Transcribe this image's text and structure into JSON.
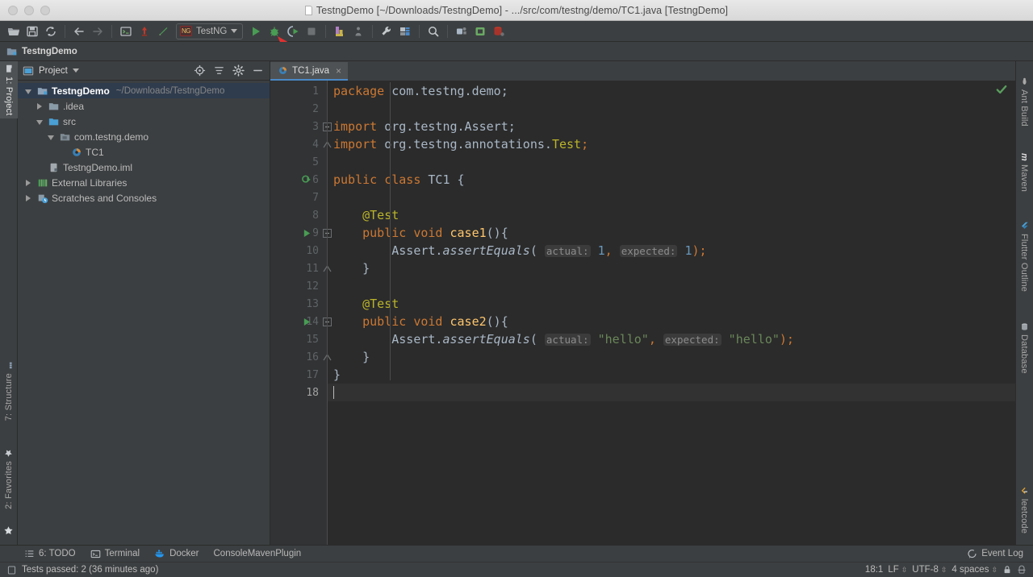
{
  "window": {
    "title": "TestngDemo [~/Downloads/TestngDemo] - .../src/com/testng/demo/TC1.java [TestngDemo]",
    "traffic_lights": [
      "close",
      "minimize",
      "zoom"
    ]
  },
  "toolbar": {
    "icons": [
      {
        "name": "open-project-icon",
        "title": "Open"
      },
      {
        "name": "save-all-icon",
        "title": "Save All"
      },
      {
        "name": "sync-icon",
        "title": "Synchronize"
      },
      {
        "name": "back-icon",
        "title": "Back"
      },
      {
        "name": "forward-icon",
        "title": "Forward"
      },
      {
        "name": "toggle-terminal-icon",
        "title": "Terminal"
      },
      {
        "name": "revert-icon",
        "title": "Revert"
      },
      {
        "name": "update-project-icon",
        "title": "Update Project"
      },
      {
        "name": "run-icon",
        "title": "Run"
      },
      {
        "name": "debug-icon",
        "title": "Debug"
      },
      {
        "name": "run-coverage-icon",
        "title": "Run with Coverage"
      },
      {
        "name": "stop-icon",
        "title": "Stop"
      },
      {
        "name": "build-icon",
        "title": "Build"
      },
      {
        "name": "profiler-icon",
        "title": "Profiler"
      },
      {
        "name": "settings-wrench-icon",
        "title": "Settings"
      },
      {
        "name": "project-structure-icon",
        "title": "Project Structure"
      },
      {
        "name": "search-icon",
        "title": "Search Everywhere"
      },
      {
        "name": "sdk-manager-icon",
        "title": "SDK Manager"
      },
      {
        "name": "avd-manager-icon",
        "title": "AVD Manager"
      },
      {
        "name": "database-icon",
        "title": "Database"
      }
    ],
    "run_config": {
      "icon": "testng-config-icon",
      "icon_text": "NG",
      "label": "TestNG",
      "caret": "chevron-down-icon"
    }
  },
  "navbar": {
    "crumb": "TestngDemo",
    "icon": "module-icon"
  },
  "left_strip": {
    "tabs": [
      {
        "label": "1: Project",
        "selected": true,
        "icon": "project-icon"
      },
      {
        "label": "7: Structure",
        "selected": false,
        "icon": "structure-icon"
      },
      {
        "label": "2: Favorites",
        "selected": false,
        "icon": "favorites-star-icon"
      }
    ],
    "bottom_icon": "favorites-star-icon"
  },
  "right_strip": {
    "tabs": [
      {
        "label": "Ant Build",
        "icon": "ant-icon"
      },
      {
        "label": "Maven",
        "icon": "maven-icon"
      },
      {
        "label": "Flutter Outline",
        "icon": "flutter-icon"
      },
      {
        "label": "Database",
        "icon": "database-icon"
      },
      {
        "label": "leetcode",
        "icon": "leetcode-icon"
      }
    ]
  },
  "project_panel": {
    "title": "Project",
    "title_icon": "project-window-icon",
    "caret": "chevron-down-icon",
    "header_icons": [
      {
        "name": "scroll-from-source-icon"
      },
      {
        "name": "collapse-all-icon"
      },
      {
        "name": "gear-icon"
      },
      {
        "name": "hide-icon"
      }
    ],
    "tree": [
      {
        "label": "TestngDemo",
        "sublabel": "~/Downloads/TestngDemo",
        "indent": 0,
        "twisty": "down",
        "icon": "module-icon",
        "selected": true,
        "bold": true
      },
      {
        "label": ".idea",
        "sublabel": "",
        "indent": 1,
        "twisty": "right",
        "icon": "folder-icon",
        "selected": false,
        "bold": false
      },
      {
        "label": "src",
        "sublabel": "",
        "indent": 1,
        "twisty": "down",
        "icon": "source-folder-icon",
        "selected": false,
        "bold": false
      },
      {
        "label": "com.testng.demo",
        "sublabel": "",
        "indent": 2,
        "twisty": "down",
        "icon": "package-icon",
        "selected": false,
        "bold": false
      },
      {
        "label": "TC1",
        "sublabel": "",
        "indent": 3,
        "twisty": "none",
        "icon": "java-class-icon",
        "selected": false,
        "bold": false
      },
      {
        "label": "TestngDemo.iml",
        "sublabel": "",
        "indent": 1,
        "twisty": "none",
        "icon": "iml-file-icon",
        "selected": false,
        "bold": false
      },
      {
        "label": "External Libraries",
        "sublabel": "",
        "indent": 0,
        "twisty": "right",
        "icon": "libraries-icon",
        "selected": false,
        "bold": false
      },
      {
        "label": "Scratches and Consoles",
        "sublabel": "",
        "indent": 0,
        "twisty": "right",
        "icon": "scratches-icon",
        "selected": false,
        "bold": false
      }
    ]
  },
  "editor": {
    "tab": {
      "label": "TC1.java",
      "icon": "java-class-icon",
      "close": "×"
    },
    "inspection_status": "ok-check-icon",
    "lines": [
      {
        "n": "1",
        "gutter": "",
        "fold": "",
        "current": false
      },
      {
        "n": "2",
        "gutter": "",
        "fold": "",
        "current": false
      },
      {
        "n": "3",
        "gutter": "",
        "fold": "collapse",
        "current": false
      },
      {
        "n": "4",
        "gutter": "",
        "fold": "end",
        "current": false
      },
      {
        "n": "5",
        "gutter": "",
        "fold": "",
        "current": false
      },
      {
        "n": "6",
        "gutter": "run-all-tests-icon",
        "fold": "",
        "current": false
      },
      {
        "n": "7",
        "gutter": "",
        "fold": "",
        "current": false
      },
      {
        "n": "8",
        "gutter": "",
        "fold": "",
        "current": false
      },
      {
        "n": "9",
        "gutter": "run-test-icon",
        "fold": "collapse",
        "current": false
      },
      {
        "n": "10",
        "gutter": "",
        "fold": "",
        "current": false
      },
      {
        "n": "11",
        "gutter": "",
        "fold": "end",
        "current": false
      },
      {
        "n": "12",
        "gutter": "",
        "fold": "",
        "current": false
      },
      {
        "n": "13",
        "gutter": "",
        "fold": "",
        "current": false
      },
      {
        "n": "14",
        "gutter": "run-test-icon",
        "fold": "collapse",
        "current": false
      },
      {
        "n": "15",
        "gutter": "",
        "fold": "",
        "current": false
      },
      {
        "n": "16",
        "gutter": "",
        "fold": "end",
        "current": false
      },
      {
        "n": "17",
        "gutter": "",
        "fold": "",
        "current": false
      },
      {
        "n": "18",
        "gutter": "",
        "fold": "",
        "current": true
      }
    ],
    "source": {
      "l1_kw": "package",
      "l1_rest": " com.testng.demo;",
      "l3_kw": "import",
      "l3_rest": " org.testng.Assert;",
      "l4_kw": "import",
      "l4_pkg": " org.testng.annotations.",
      "l4_cls": "Test",
      "l4_semi": ";",
      "l6_kw1": "public",
      "l6_kw2": "class",
      "l6_name": "TC1",
      "l6_brace": "{",
      "l8_ann": "@Test",
      "l9_kw1": "public",
      "l9_kw2": "void",
      "l9_name": "case1",
      "l9_tail": "(){",
      "l10_recv": "Assert.",
      "l10_mth": "assertEquals",
      "l10_open": "(",
      "l10_h1": "actual:",
      "l10_v1": "1",
      "l10_comma": ",",
      "l10_h2": "expected:",
      "l10_v2": "1",
      "l10_close": ");",
      "l11_brace": "}",
      "l13_ann": "@Test",
      "l14_kw1": "public",
      "l14_kw2": "void",
      "l14_name": "case2",
      "l14_tail": "(){",
      "l15_recv": "Assert.",
      "l15_mth": "assertEquals",
      "l15_open": "(",
      "l15_h1": "actual:",
      "l15_v1": "\"hello\"",
      "l15_comma": ",",
      "l15_h2": "expected:",
      "l15_v2": "\"hello\"",
      "l15_close": ");",
      "l16_brace": "}",
      "l17_brace": "}"
    }
  },
  "bottom_bar": {
    "items": [
      {
        "label": "6: TODO",
        "icon": "todo-icon"
      },
      {
        "label": "Terminal",
        "icon": "terminal-icon"
      },
      {
        "label": "Docker",
        "icon": "docker-icon"
      },
      {
        "label": "ConsoleMavenPlugin",
        "icon": ""
      }
    ],
    "event_log": {
      "label": "Event Log",
      "icon": "event-log-icon"
    }
  },
  "status_bar": {
    "message": "Tests passed: 2 (36 minutes ago)",
    "message_icon": "notification-icon",
    "caret_position": "18:1",
    "line_separator": "LF",
    "encoding": "UTF-8",
    "indent": "4 spaces",
    "lock_icon": "lock-icon",
    "inspection_icon": "inspection-eye-icon"
  },
  "annotation": {
    "arrow": "red-pointer-arrow",
    "points_to": "run-button"
  },
  "colors": {
    "accent_blue": "#4a88c7",
    "run_green": "#499c54",
    "keyword_orange": "#cc7832",
    "string_green": "#6a8759",
    "number_blue": "#6897bb",
    "annotation_yellow": "#bbb529",
    "method_yellow": "#ffc66d",
    "editor_bg": "#2b2b2b",
    "panel_bg": "#3c3f41",
    "selection_bg": "#2f3c4e",
    "annotation_red": "#e03131"
  }
}
